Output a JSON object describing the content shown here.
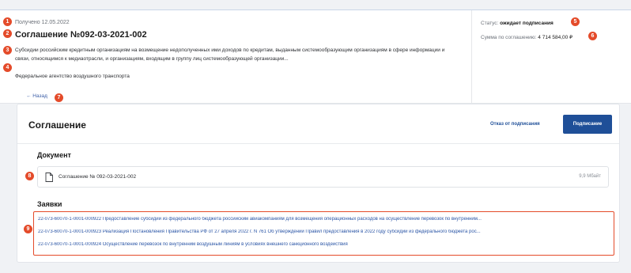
{
  "header": {
    "received": "Получено 12.05.2022",
    "title": "Соглашение №092-03-2021-002",
    "description": "Субсидии российским кредитным организациям на возмещение недополученных ими доходов по кредитам, выданным системообразующим организациям в сфере информации и связи, относящимся к медиаотрасли, и организациям, входящим в группу лиц системообразующей организации...",
    "agency": "Федеральное агентство воздушного транспорта",
    "status_label": "Статус:",
    "status_value": "ожидает подписания",
    "sum_label": "Сумма по соглашению:",
    "sum_value": "4 714 584,00 ₽"
  },
  "nav": {
    "back": "← Назад"
  },
  "card": {
    "title": "Соглашение",
    "refuse_label": "Отказ от подписания",
    "sign_label": "Подписание"
  },
  "document": {
    "section_title": "Документ",
    "name": "Соглашение № 092-03-2021-002",
    "size": "9,9 Мбайт"
  },
  "requests": {
    "section_title": "Заявки",
    "items": [
      "22-073-60070-1-0001-000922 Предоставление субсидий из федерального бюджета российским авиакомпаниям для возмещения операционных расходов на осуществление перевозок по внутренним...",
      "22-073-60070-1-0001-000923 Реализация Постановления Правительства РФ от 27 апреля 2022 г. N 761 Об утверждении Правил предоставления в 2022 году субсидий из федерального бюджета рос...",
      "22-073-60070-1-0001-000924 Осуществление перевозок по внутренним воздушным линиям в условиях внешнего санкционного воздействия"
    ]
  },
  "markers": [
    "1",
    "2",
    "3",
    "4",
    "5",
    "6",
    "7",
    "8",
    "9"
  ],
  "colors": {
    "accent": "#1f4f98",
    "marker": "#e44b2a",
    "link": "#2a55a6"
  }
}
